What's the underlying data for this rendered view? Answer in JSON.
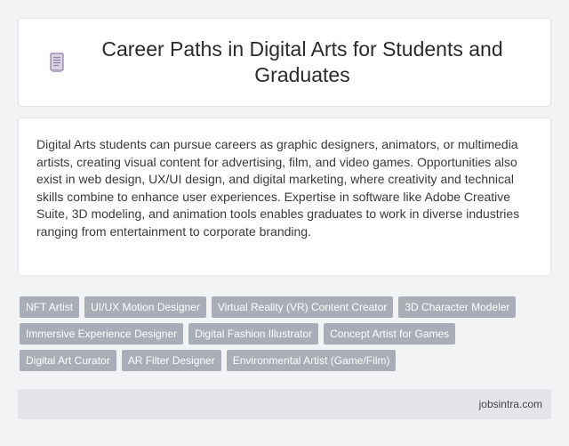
{
  "header": {
    "icon": "document-icon",
    "title": "Career Paths in Digital Arts for Students and Graduates"
  },
  "description": "Digital Arts students can pursue careers as graphic designers, animators, or multimedia artists, creating visual content for advertising, film, and video games. Opportunities also exist in web design, UX/UI design, and digital marketing, where creativity and technical skills combine to enhance user experiences. Expertise in software like Adobe Creative Suite, 3D modeling, and animation tools enables graduates to work in diverse industries ranging from entertainment to corporate branding.",
  "tags": [
    "NFT Artist",
    "UI/UX Motion Designer",
    "Virtual Reality (VR) Content Creator",
    "3D Character Modeler",
    "Immersive Experience Designer",
    "Digital Fashion Illustrator",
    "Concept Artist for Games",
    "Digital Art Curator",
    "AR Filter Designer",
    "Environmental Artist (Game/Film)"
  ],
  "footer": {
    "source": "jobsintra.com"
  },
  "colors": {
    "tag_bg": "#a8adb8",
    "page_bg": "#f2f3f5",
    "footer_bg": "#e4e5e9",
    "icon": "#8e7fa6"
  }
}
